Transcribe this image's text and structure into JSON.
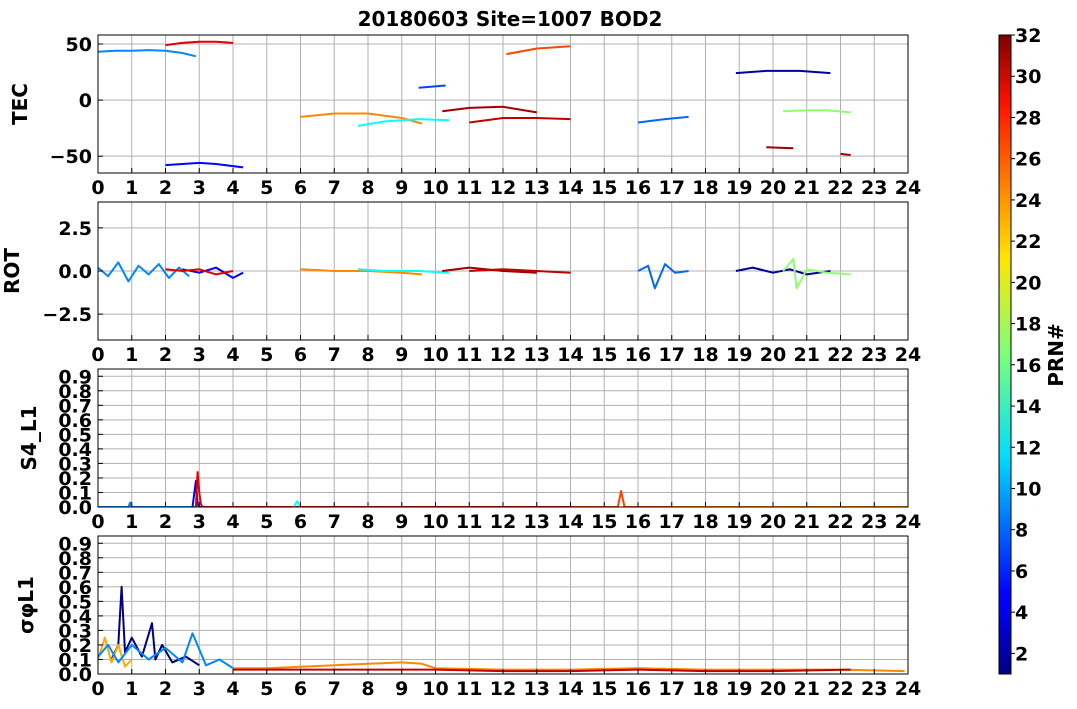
{
  "title": "20180603 Site=1007 BOD2",
  "chart_data": [
    {
      "type": "line",
      "id": "tec",
      "ylabel": "TEC",
      "xlim": [
        0,
        24
      ],
      "ylim": [
        -65,
        58
      ],
      "yticks": [
        -50,
        0,
        50
      ],
      "xticks": [
        0,
        1,
        2,
        3,
        4,
        5,
        6,
        7,
        8,
        9,
        10,
        11,
        12,
        13,
        14,
        15,
        16,
        17,
        18,
        19,
        20,
        21,
        22,
        23,
        24
      ],
      "grid": true,
      "series": [
        {
          "prn": 9,
          "x": [
            0,
            0.5,
            1,
            1.5,
            2,
            2.5,
            2.9
          ],
          "y": [
            43,
            44,
            44,
            44.5,
            44,
            42,
            39
          ]
        },
        {
          "prn": 29,
          "x": [
            2,
            2.5,
            3,
            3.5,
            4
          ],
          "y": [
            49,
            51,
            52,
            52,
            51
          ]
        },
        {
          "prn": 5,
          "x": [
            2,
            2.5,
            3,
            3.5,
            4.3
          ],
          "y": [
            -58,
            -57,
            -56,
            -57,
            -60
          ]
        },
        {
          "prn": 24,
          "x": [
            6,
            7,
            8,
            9,
            9.6
          ],
          "y": [
            -15,
            -12,
            -12,
            -16,
            -21
          ]
        },
        {
          "prn": 13,
          "x": [
            7.7,
            8.5,
            9.5,
            10.4
          ],
          "y": [
            -23,
            -19,
            -17,
            -18
          ]
        },
        {
          "prn": 7,
          "x": [
            9.5,
            10.3
          ],
          "y": [
            11,
            13
          ]
        },
        {
          "prn": 31,
          "x": [
            10.2,
            11,
            12,
            13
          ],
          "y": [
            -10,
            -7,
            -6,
            -11
          ]
        },
        {
          "prn": 30,
          "x": [
            11,
            12,
            13,
            14
          ],
          "y": [
            -20,
            -16,
            -16,
            -17
          ]
        },
        {
          "prn": 26,
          "x": [
            12.1,
            13,
            14
          ],
          "y": [
            41,
            46,
            48
          ]
        },
        {
          "prn": 8,
          "x": [
            16,
            16.8,
            17.5
          ],
          "y": [
            -20,
            -17,
            -15
          ]
        },
        {
          "prn": 2,
          "x": [
            18.9,
            19.8,
            20.8,
            21.7
          ],
          "y": [
            24,
            26,
            26,
            24
          ]
        },
        {
          "prn": 31,
          "x": [
            19.8,
            20.6
          ],
          "y": [
            -42,
            -43
          ]
        },
        {
          "prn": 17,
          "x": [
            20.3,
            21,
            21.6,
            22.3
          ],
          "y": [
            -10,
            -9,
            -9,
            -11
          ]
        },
        {
          "prn": 31,
          "x": [
            22,
            22.3
          ],
          "y": [
            -48,
            -49
          ]
        }
      ]
    },
    {
      "type": "line",
      "id": "rot",
      "ylabel": "ROT",
      "xlim": [
        0,
        24
      ],
      "ylim": [
        -4,
        4
      ],
      "yticks": [
        -2.5,
        0.0,
        2.5
      ],
      "xticks": [
        0,
        1,
        2,
        3,
        4,
        5,
        6,
        7,
        8,
        9,
        10,
        11,
        12,
        13,
        14,
        15,
        16,
        17,
        18,
        19,
        20,
        21,
        22,
        23,
        24
      ],
      "grid": true,
      "series": [
        {
          "prn": 9,
          "x": [
            0,
            0.3,
            0.6,
            0.9,
            1.2,
            1.5,
            1.8,
            2.1,
            2.4,
            2.7
          ],
          "y": [
            0.2,
            -0.3,
            0.5,
            -0.6,
            0.3,
            -0.2,
            0.4,
            -0.4,
            0.2,
            -0.3
          ]
        },
        {
          "prn": 5,
          "x": [
            2.5,
            3,
            3.5,
            4,
            4.3
          ],
          "y": [
            0.1,
            -0.1,
            0.2,
            -0.4,
            -0.1
          ]
        },
        {
          "prn": 29,
          "x": [
            2,
            2.5,
            3,
            3.5,
            4
          ],
          "y": [
            0.1,
            0.0,
            0.1,
            -0.2,
            0.0
          ]
        },
        {
          "prn": 24,
          "x": [
            6,
            7,
            8,
            9,
            9.6
          ],
          "y": [
            0.1,
            0.0,
            0.0,
            -0.1,
            -0.2
          ]
        },
        {
          "prn": 13,
          "x": [
            7.7,
            8.5,
            9.5,
            10.4
          ],
          "y": [
            0.1,
            0.0,
            0.0,
            -0.1
          ]
        },
        {
          "prn": 31,
          "x": [
            10.2,
            11,
            12,
            13
          ],
          "y": [
            0.0,
            0.2,
            0.0,
            -0.1
          ]
        },
        {
          "prn": 30,
          "x": [
            11,
            12,
            13,
            14
          ],
          "y": [
            0.0,
            0.1,
            0.0,
            -0.1
          ]
        },
        {
          "prn": 8,
          "x": [
            16,
            16.3,
            16.5,
            16.8,
            17.1,
            17.5
          ],
          "y": [
            0.0,
            0.3,
            -1.0,
            0.4,
            -0.1,
            0.0
          ]
        },
        {
          "prn": 2,
          "x": [
            18.9,
            19.4,
            20,
            20.5,
            21,
            21.7
          ],
          "y": [
            0.0,
            0.2,
            -0.1,
            0.1,
            -0.2,
            0.0
          ]
        },
        {
          "prn": 17,
          "x": [
            20.3,
            20.6,
            20.7,
            21,
            21.6,
            22.3
          ],
          "y": [
            0.0,
            0.7,
            -1.0,
            0.1,
            -0.1,
            -0.2
          ]
        }
      ]
    },
    {
      "type": "line",
      "id": "s4",
      "ylabel": "S4_L1",
      "xlim": [
        0,
        24
      ],
      "ylim": [
        0,
        0.95
      ],
      "yticks": [
        0.0,
        0.1,
        0.2,
        0.3,
        0.4,
        0.5,
        0.6,
        0.7,
        0.8,
        0.9
      ],
      "xticks": [
        0,
        1,
        2,
        3,
        4,
        5,
        6,
        7,
        8,
        9,
        10,
        11,
        12,
        13,
        14,
        15,
        16,
        17,
        18,
        19,
        20,
        21,
        22,
        23,
        24
      ],
      "grid": true,
      "series": [
        {
          "prn": 9,
          "x": [
            0,
            0.9,
            0.95,
            1.0,
            2.9
          ],
          "y": [
            0.0,
            0.0,
            0.03,
            0.0,
            0.0
          ]
        },
        {
          "prn": 5,
          "x": [
            2.8,
            2.9,
            2.95,
            3.0,
            4.3
          ],
          "y": [
            0.0,
            0.18,
            0.02,
            0.0,
            0.0
          ]
        },
        {
          "prn": 29,
          "x": [
            2.9,
            2.95,
            3.0,
            3.05,
            3.1,
            14
          ],
          "y": [
            0.0,
            0.24,
            0.1,
            0.02,
            0.0,
            0.0
          ]
        },
        {
          "prn": 13,
          "x": [
            5.8,
            5.9,
            6.0
          ],
          "y": [
            0.0,
            0.04,
            0.0
          ]
        },
        {
          "prn": 26,
          "x": [
            14,
            15.4,
            15.5,
            15.6,
            17
          ],
          "y": [
            0.0,
            0.0,
            0.11,
            0.0,
            0.0
          ]
        },
        {
          "prn": 24,
          "x": [
            17,
            24
          ],
          "y": [
            0.0,
            0.0
          ]
        }
      ]
    },
    {
      "type": "line",
      "id": "sigphi",
      "ylabel": "σφL1",
      "xlim": [
        0,
        24
      ],
      "ylim": [
        0,
        0.95
      ],
      "yticks": [
        0.0,
        0.1,
        0.2,
        0.3,
        0.4,
        0.5,
        0.6,
        0.7,
        0.8,
        0.9
      ],
      "xticks": [
        0,
        1,
        2,
        3,
        4,
        5,
        6,
        7,
        8,
        9,
        10,
        11,
        12,
        13,
        14,
        15,
        16,
        17,
        18,
        19,
        20,
        21,
        22,
        23,
        24
      ],
      "grid": true,
      "series": [
        {
          "prn": 1,
          "x": [
            0.4,
            0.6,
            0.7,
            0.8,
            1.0,
            1.3,
            1.6,
            1.7,
            1.9,
            2.2,
            2.6,
            3.0
          ],
          "y": [
            0.1,
            0.2,
            0.6,
            0.15,
            0.25,
            0.12,
            0.35,
            0.1,
            0.2,
            0.08,
            0.12,
            0.06
          ]
        },
        {
          "prn": 23,
          "x": [
            0.0,
            0.2,
            0.4,
            0.6,
            0.8,
            1.0
          ],
          "y": [
            0.1,
            0.25,
            0.08,
            0.2,
            0.05,
            0.1
          ]
        },
        {
          "prn": 9,
          "x": [
            0.0,
            0.3,
            0.6,
            1.0,
            1.5,
            2.0,
            2.5,
            2.8,
            3.2,
            3.6,
            4.0
          ],
          "y": [
            0.12,
            0.2,
            0.08,
            0.2,
            0.1,
            0.18,
            0.08,
            0.28,
            0.06,
            0.1,
            0.04
          ]
        },
        {
          "prn": 24,
          "x": [
            4,
            5,
            6,
            7,
            8,
            9,
            9.6,
            10,
            12,
            14,
            16,
            18,
            20,
            22,
            23.9
          ],
          "y": [
            0.04,
            0.04,
            0.05,
            0.06,
            0.07,
            0.08,
            0.07,
            0.04,
            0.03,
            0.03,
            0.04,
            0.03,
            0.03,
            0.03,
            0.02
          ]
        },
        {
          "prn": 30,
          "x": [
            4,
            6,
            8,
            10,
            12,
            14,
            16,
            18,
            20,
            22.3
          ],
          "y": [
            0.03,
            0.03,
            0.03,
            0.03,
            0.02,
            0.02,
            0.03,
            0.02,
            0.02,
            0.03
          ]
        }
      ]
    }
  ],
  "colorbar": {
    "label": "PRN#",
    "range": [
      1,
      32
    ],
    "ticks": [
      2,
      4,
      6,
      8,
      10,
      12,
      14,
      16,
      18,
      20,
      22,
      24,
      26,
      28,
      30,
      32
    ]
  }
}
